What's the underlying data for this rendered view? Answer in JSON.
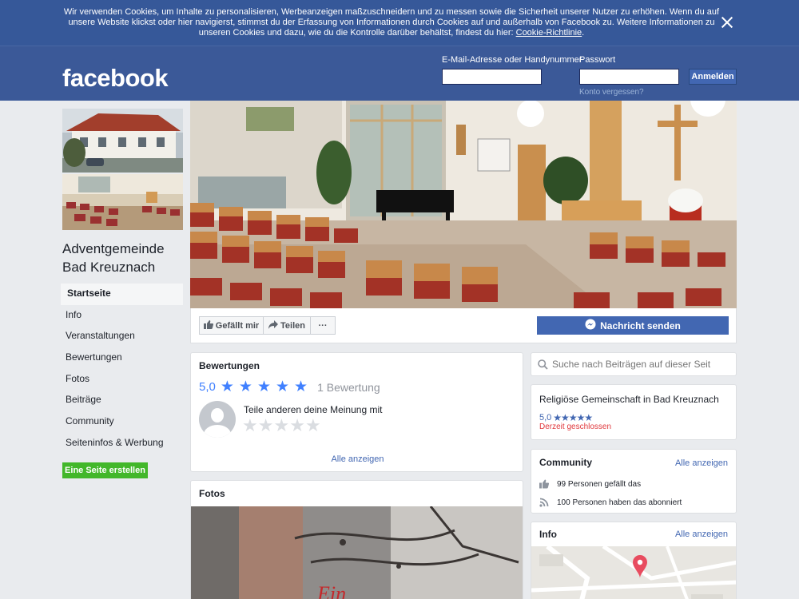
{
  "cookie_banner": {
    "text": "Wir verwenden Cookies, um Inhalte zu personalisieren, Werbeanzeigen maßzuschneidern und zu messen sowie die Sicherheit unserer Nutzer zu erhöhen. Wenn du auf unsere Website klickst oder hier navigierst, stimmst du der Erfassung von Informationen durch Cookies auf und außerhalb von Facebook zu. Weitere Informationen zu unseren Cookies und dazu, wie du die Kontrolle darüber behältst, findest du hier:",
    "link": "Cookie-Richtlinie",
    "suffix": "."
  },
  "header": {
    "logo": "facebook",
    "email_label": "E-Mail-Adresse oder Handynummer",
    "email_value": "",
    "password_label": "Passwort",
    "password_value": "",
    "login_button": "Anmelden",
    "forgot_link": "Konto vergessen?"
  },
  "page": {
    "name_line1": "Adventgemeinde",
    "name_line2": "Bad Kreuznach"
  },
  "nav": {
    "items": [
      {
        "label": "Startseite",
        "active": true
      },
      {
        "label": "Info"
      },
      {
        "label": "Veranstaltungen"
      },
      {
        "label": "Bewertungen"
      },
      {
        "label": "Fotos"
      },
      {
        "label": "Beiträge"
      },
      {
        "label": "Community"
      },
      {
        "label": "Seiteninfos & Werbung"
      }
    ],
    "create_page": "Eine Seite erstellen"
  },
  "actions": {
    "like": "Gefällt mir",
    "share": "Teilen",
    "more": "···",
    "message": "Nachricht senden"
  },
  "reviews": {
    "title": "Bewertungen",
    "score": "5,0",
    "rating_stars": 5,
    "count": "1 Bewertung",
    "prompt": "Teile anderen deine Meinung mit",
    "show_all": "Alle anzeigen"
  },
  "photos": {
    "title": "Fotos"
  },
  "search": {
    "placeholder": "Suche nach Beiträgen auf dieser Seit"
  },
  "about": {
    "category": "Religiöse Gemeinschaft in Bad Kreuznach",
    "score": "5,0",
    "stars": "★★★★★",
    "status": "Derzeit geschlossen"
  },
  "community": {
    "title": "Community",
    "show_all": "Alle anzeigen",
    "likes": "99 Personen gefällt das",
    "follows": "100 Personen haben das abonniert"
  },
  "info": {
    "title": "Info",
    "show_all": "Alle anzeigen"
  },
  "colors": {
    "brand": "#3b5998",
    "button_blue": "#4267b2",
    "green": "#42b72a",
    "star": "#4080ff",
    "closed": "#e0393e"
  }
}
